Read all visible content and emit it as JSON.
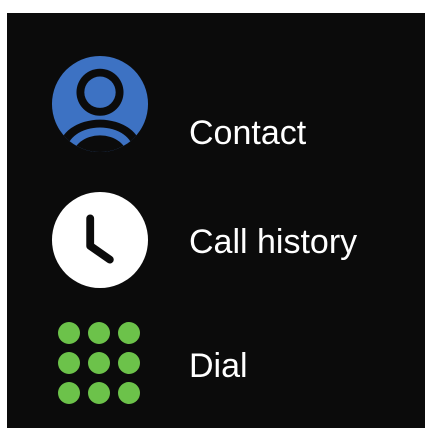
{
  "menu": {
    "items": [
      {
        "label": "Contact",
        "icon": "contact-person-icon",
        "icon_color": "#3d72c3"
      },
      {
        "label": "Call history",
        "icon": "clock-icon",
        "icon_color": "#ffffff"
      },
      {
        "label": "Dial",
        "icon": "dialpad-icon",
        "icon_color": "#6cc24a"
      }
    ]
  },
  "colors": {
    "background": "#0b0b0b",
    "text": "#ffffff"
  }
}
